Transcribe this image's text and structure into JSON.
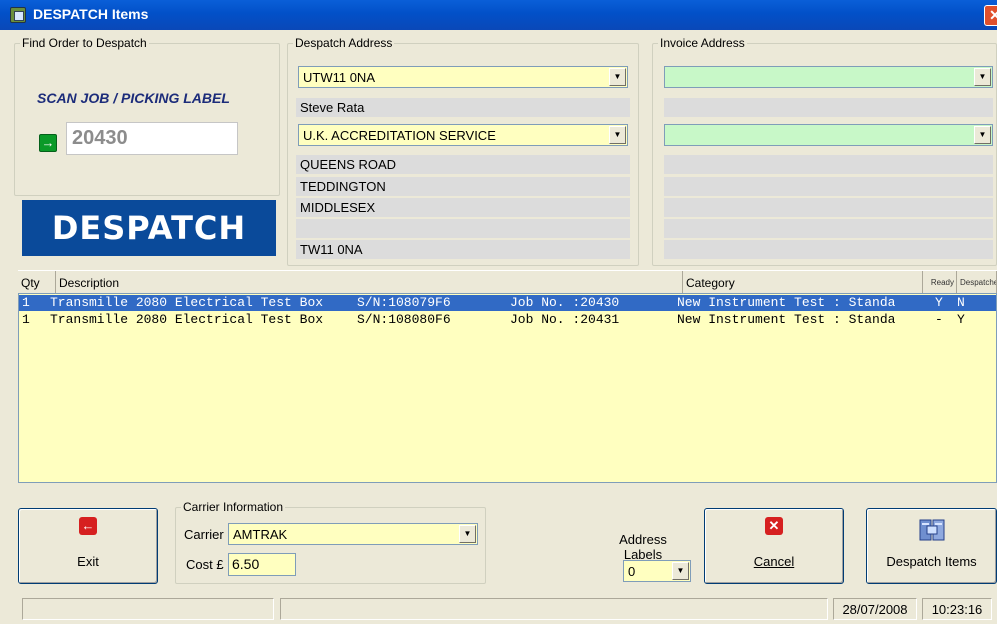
{
  "window": {
    "title": "DESPATCH Items",
    "close_label": "✕"
  },
  "find_order": {
    "legend": "Find Order to  Despatch",
    "scan_label": "SCAN JOB / PICKING LABEL",
    "arrow_icon": "→",
    "job_value": "20430"
  },
  "banner": "DESPATCH",
  "despatch_address": {
    "legend": "Despatch Address",
    "postcode_select": "UTW11 0NA",
    "contact": "Steve Rata",
    "company_select": "U.K. ACCREDITATION SERVICE",
    "lines": [
      "QUEENS ROAD",
      "TEDDINGTON",
      "MIDDLESEX",
      "",
      "TW11 0NA"
    ]
  },
  "invoice_address": {
    "legend": "Invoice Address",
    "postcode_select": "",
    "company_select": "",
    "lines": [
      "",
      "",
      "",
      "",
      "",
      ""
    ]
  },
  "items_list": {
    "headers": {
      "qty": "Qty",
      "description": "Description",
      "category": "Category",
      "ready": "Ready",
      "despatched": "Despatched"
    },
    "rows": [
      {
        "qty": "1",
        "description": "Transmille 2080 Electrical Test Box",
        "serial": "S/N:108079F6",
        "job": "Job No. :20430",
        "category": "New Instrument Test : Standa",
        "ready": "Y",
        "despatched": "N",
        "selected": true
      },
      {
        "qty": "1",
        "description": "Transmille 2080 Electrical Test Box",
        "serial": "S/N:108080F6",
        "job": "Job No. :20431",
        "category": "New Instrument Test : Standa",
        "ready": "-",
        "despatched": "Y",
        "selected": false
      }
    ]
  },
  "buttons": {
    "exit": "Exit",
    "cancel": "Cancel",
    "despatch_items": "Despatch Items"
  },
  "carrier": {
    "legend": "Carrier Information",
    "carrier_label": "Carrier",
    "carrier_value": "AMTRAK",
    "cost_label": "Cost £",
    "cost_value": "6.50"
  },
  "address_labels": {
    "label_line1": "Address",
    "label_line2": "Labels",
    "value": "0"
  },
  "status": {
    "date": "28/07/2008",
    "time": "10:23:16"
  },
  "colors": {
    "input_yellow": "#ffffc0",
    "input_green": "#c8f8c8",
    "banner_blue": "#0a4a9a",
    "selection": "#316ac5"
  }
}
